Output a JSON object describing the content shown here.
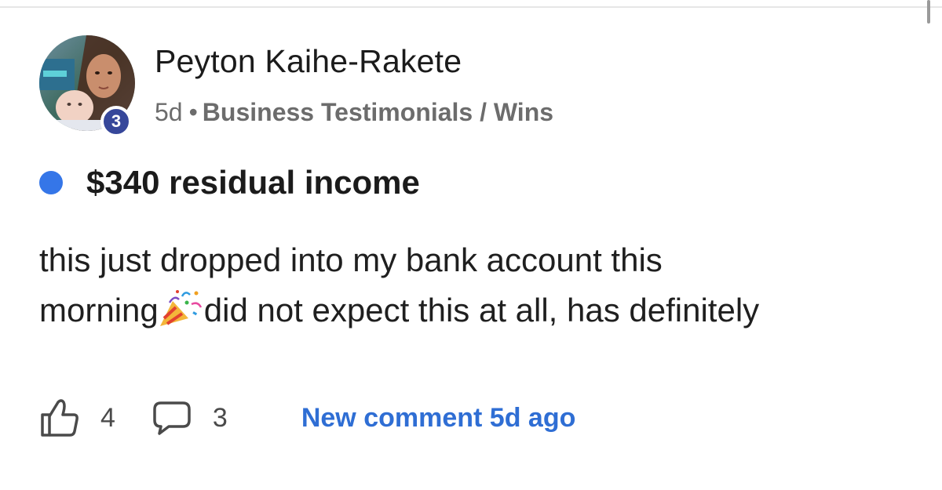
{
  "post": {
    "author": {
      "name": "Peyton Kaihe-Rakete",
      "level": "3"
    },
    "meta": {
      "time": "5d",
      "separator": "•",
      "category": "Business Testimonials / Wins"
    },
    "title": "$340 residual income",
    "body": {
      "line1": "this just dropped into my bank account this",
      "line2_before_emoji": "morning",
      "line2_after_emoji": "did not expect this at all, has definitely"
    },
    "emoji": "party-popper",
    "stats": {
      "likes": "4",
      "comments": "3",
      "new_comment": "New comment 5d ago"
    }
  },
  "colors": {
    "unread_dot": "#3576e8",
    "level_badge": "#36479a",
    "link": "#2f6ed4",
    "meta_text": "#6c6c6c"
  }
}
